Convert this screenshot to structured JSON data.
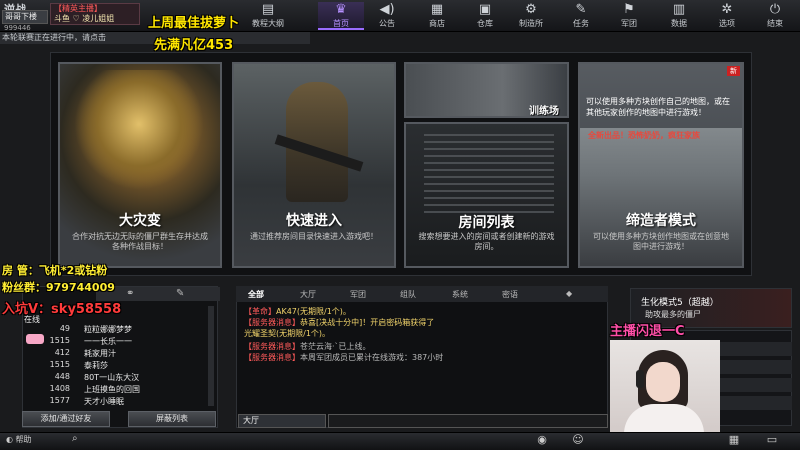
{
  "app": {
    "logo": "逆战",
    "user_name": "哥哥下楼",
    "user_id": "999446"
  },
  "chat_badge": {
    "line1": "【精英主播】",
    "line2": "斗鱼 ♡ 凌儿姐姐"
  },
  "nav": {
    "items": [
      {
        "label": "教程大纲",
        "icon": "book-icon"
      },
      {
        "label": "首页",
        "icon": "crown-icon"
      },
      {
        "label": "公告",
        "icon": "speaker-icon"
      },
      {
        "label": "商店",
        "icon": "shop-icon"
      },
      {
        "label": "仓库",
        "icon": "chest-icon"
      },
      {
        "label": "制造所",
        "icon": "gear-icon"
      },
      {
        "label": "任务",
        "icon": "task-icon"
      },
      {
        "label": "军团",
        "icon": "flag-icon"
      },
      {
        "label": "数据",
        "icon": "chart-icon"
      },
      {
        "label": "选项",
        "icon": "settings-icon"
      },
      {
        "label": "结束",
        "icon": "power-icon"
      }
    ],
    "active": "首页"
  },
  "notice": "本轮联赛正在进行中，请点击",
  "overlay": {
    "top_line1": "上周最佳拔萝卜",
    "top_line2": "先满凡亿453",
    "room_admin": "房  管：飞机*2或钻粉",
    "fans_group": "粉丝群：979744009",
    "pit_v": "入坑V：sky58558",
    "host_link": "主播闪退一C"
  },
  "cards": {
    "disaster": {
      "title": "大灾变",
      "desc": "合作对抗无边无际的僵尸群生存并达成各种作战目标！"
    },
    "quick": {
      "title": "快速进入",
      "desc": "通过推荐房间目录快速进入游戏吧！"
    },
    "training": {
      "title": "训练场"
    },
    "rooms": {
      "title": "房间列表",
      "desc": "搜索想要进入的房间或者创建新的游戏房间。"
    },
    "shrink": {
      "title": "缔造者模式",
      "top_text": "可以使用多种方块创作自己的地图，或在其他玩家创作的地图中进行游戏！",
      "red_text": "全新出品！恐怖奶奶，疯狂家族",
      "desc": "可以使用多种方块创作地图或在创意地图中进行游戏！",
      "badge": "新"
    }
  },
  "friends": {
    "online_label": "在线",
    "rows": [
      {
        "num": "49",
        "name": "粒粒娜娜梦梦"
      },
      {
        "num": "1515",
        "name": "一一长乐一一"
      },
      {
        "num": "412",
        "name": "耗家用汁"
      },
      {
        "num": "1515",
        "name": "泰莉莎"
      },
      {
        "num": "448",
        "name": "80T一山东大汉"
      },
      {
        "num": "1408",
        "name": "上班摸鱼的回国"
      },
      {
        "num": "1577",
        "name": "天才小睡眠"
      }
    ],
    "btn_add": "添加/通过好友",
    "btn_block": "屏蔽列表"
  },
  "chat": {
    "tabs": [
      "全部",
      "大厅",
      "军团",
      "组队",
      "系统",
      "密语"
    ],
    "active_tab": "全部",
    "lines": [
      {
        "tag": "【革命】",
        "text": "AK47(无期限/1个)。",
        "color": "yel"
      },
      {
        "tag": "【服务器消息】",
        "text": "恭喜[决战十分中]！开启密码箱获得了",
        "color": "yel"
      },
      {
        "tag": "",
        "text": "光耀圣契(无期限/1个)。",
        "color": "yel"
      },
      {
        "tag": "【服务器消息】",
        "text": "苍茫云海·`已上线。",
        "color": "gry"
      },
      {
        "tag": "【服务器消息】",
        "text": "本周军团成员已累计在线游戏：387小时",
        "color": "gry"
      }
    ],
    "channel": "大厅"
  },
  "right_ad": {
    "line1": "生化模式5（超越）",
    "line2": "助攻最多的僵尸"
  },
  "bottom": {
    "help": "帮助"
  }
}
